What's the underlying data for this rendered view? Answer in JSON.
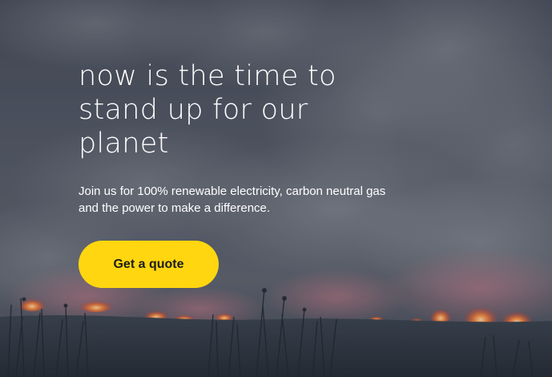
{
  "hero": {
    "headline": "now is the time to stand up for our planet",
    "subtext": "Join us for 100% renewable electricity, carbon neutral gas and the power to make a difference.",
    "cta_label": "Get a quote",
    "background_image": "wildfire-smoke-landscape"
  },
  "colors": {
    "accent": "#ffd60f",
    "text": "#ffffff",
    "button_text": "#1c1c1c",
    "smoke": "#4a525e",
    "fire": "#ff5a2a"
  }
}
